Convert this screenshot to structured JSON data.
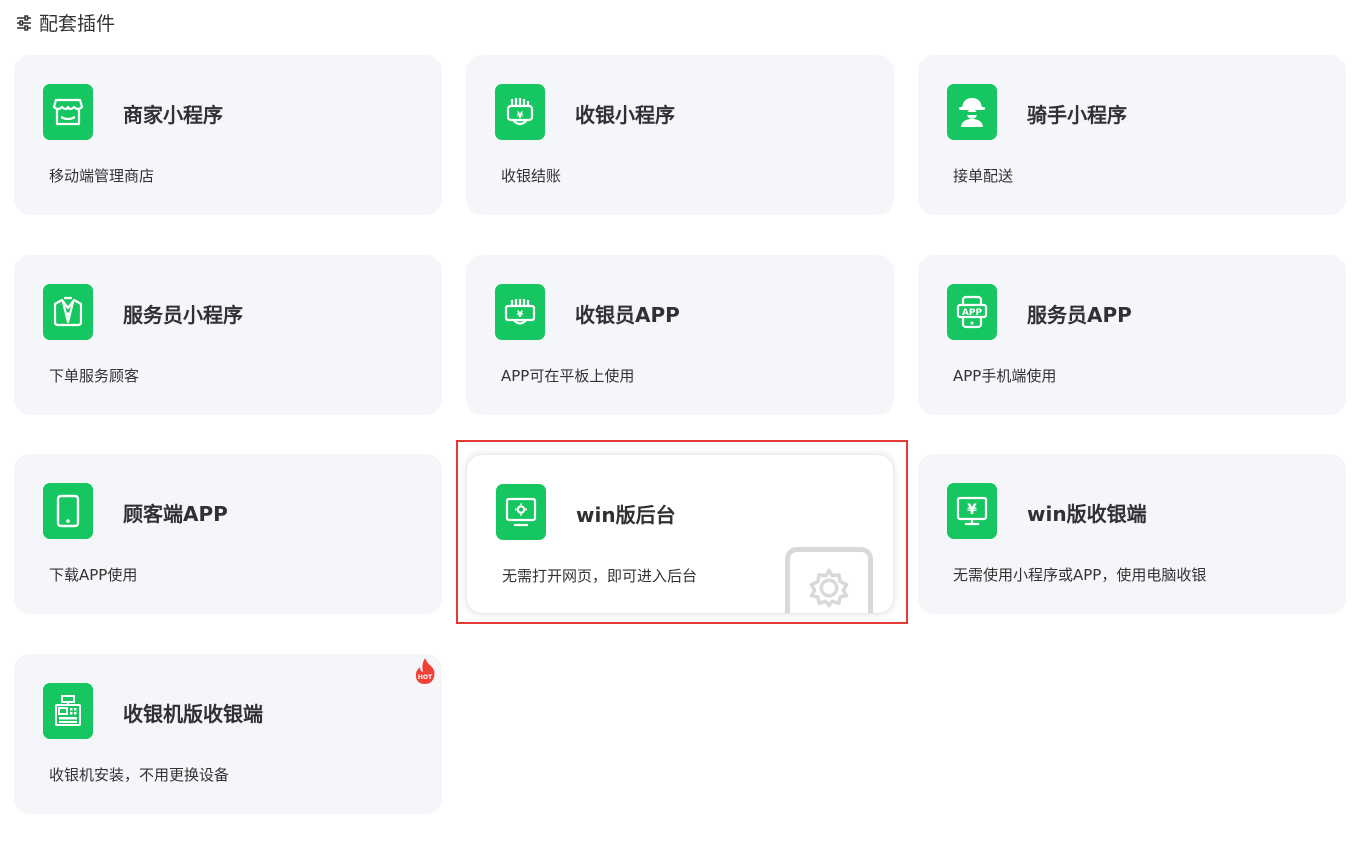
{
  "header": {
    "title": "配套插件",
    "icon": "sliders-icon"
  },
  "colors": {
    "accent": "#16c660",
    "card_bg": "#f5f6f9",
    "highlight": "#e53935",
    "hot": "#f04134"
  },
  "cards": [
    {
      "title": "商家小程序",
      "desc": "移动端管理商店",
      "icon": "shop-icon"
    },
    {
      "title": "收银小程序",
      "desc": "收银结账",
      "icon": "hand-cash-icon"
    },
    {
      "title": "骑手小程序",
      "desc": "接单配送",
      "icon": "rider-icon"
    },
    {
      "title": "服务员小程序",
      "desc": "下单服务顾客",
      "icon": "waiter-icon"
    },
    {
      "title": "收银员APP",
      "desc": "APP可在平板上使用",
      "icon": "cashier-app-icon"
    },
    {
      "title": "服务员APP",
      "desc": "APP手机端使用",
      "icon": "phone-app-icon",
      "icon_text": "APP"
    },
    {
      "title": "顾客端APP",
      "desc": "下载APP使用",
      "icon": "tablet-icon"
    },
    {
      "title": "win版后台",
      "desc": "无需打开网页，即可进入后台",
      "icon": "monitor-gear-icon",
      "active": true
    },
    {
      "title": "win版收银端",
      "desc": "无需使用小程序或APP，使用电脑收银",
      "icon": "monitor-yen-icon"
    },
    {
      "title": "收银机版收银端",
      "desc": "收银机安装，不用更换设备",
      "icon": "cash-register-icon",
      "badge": "HOT"
    }
  ]
}
